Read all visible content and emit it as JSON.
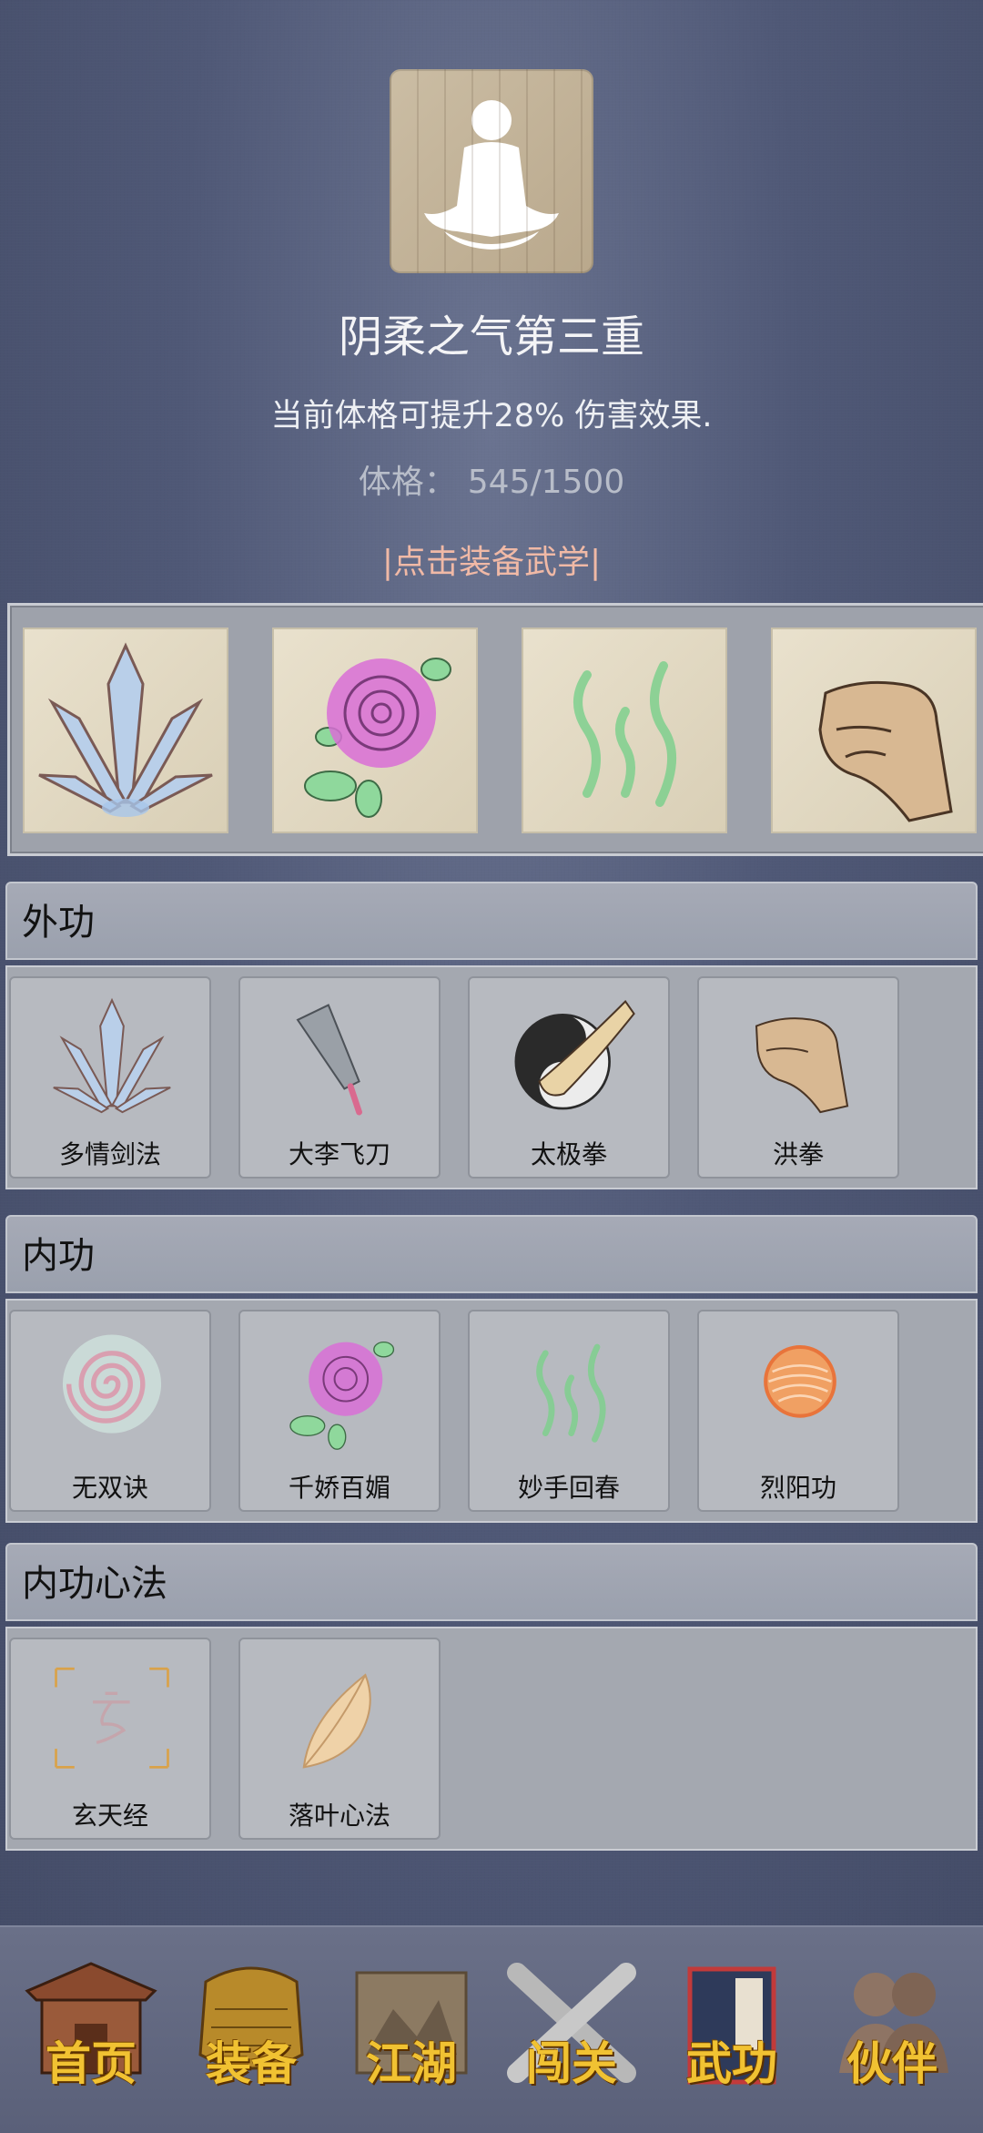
{
  "header": {
    "title": "阴柔之气第三重",
    "description": "当前体格可提升28% 伤害效果.",
    "stat_label": "体格：",
    "stat_value": "545/1500",
    "equip_link": "|点击装备武学|"
  },
  "equipped": {
    "slots": [
      {
        "icon": "crystal-blades-icon"
      },
      {
        "icon": "rose-icon"
      },
      {
        "icon": "green-wisps-icon"
      },
      {
        "icon": "fist-icon"
      }
    ]
  },
  "sections": {
    "outer": {
      "title": "外功",
      "items": [
        {
          "label": "多情剑法",
          "icon": "crystal-blades-icon"
        },
        {
          "label": "大李飞刀",
          "icon": "flying-knife-icon"
        },
        {
          "label": "太极拳",
          "icon": "taiji-fist-icon"
        },
        {
          "label": "洪拳",
          "icon": "fist-icon"
        }
      ]
    },
    "inner": {
      "title": "内功",
      "items": [
        {
          "label": "无双诀",
          "icon": "spiral-icon"
        },
        {
          "label": "千娇百媚",
          "icon": "rose-icon"
        },
        {
          "label": "妙手回春",
          "icon": "green-wisps-icon"
        },
        {
          "label": "烈阳功",
          "icon": "sun-orb-icon"
        }
      ]
    },
    "mind": {
      "title": "内功心法",
      "items": [
        {
          "label": "玄天经",
          "icon": "xuan-scroll-icon"
        },
        {
          "label": "落叶心法",
          "icon": "leaf-icon"
        }
      ]
    }
  },
  "nav": {
    "items": [
      {
        "label": "首页",
        "icon": "pavilion-icon"
      },
      {
        "label": "装备",
        "icon": "armor-icon"
      },
      {
        "label": "江湖",
        "icon": "map-scroll-icon"
      },
      {
        "label": "闯关",
        "icon": "crossed-swords-icon"
      },
      {
        "label": "武功",
        "icon": "manual-book-icon",
        "active": true
      },
      {
        "label": "伙伴",
        "icon": "companions-icon"
      }
    ]
  },
  "colors": {
    "background": "#4f5876",
    "equip_link": "#f0b9a6",
    "nav_label": "#f1c232"
  }
}
